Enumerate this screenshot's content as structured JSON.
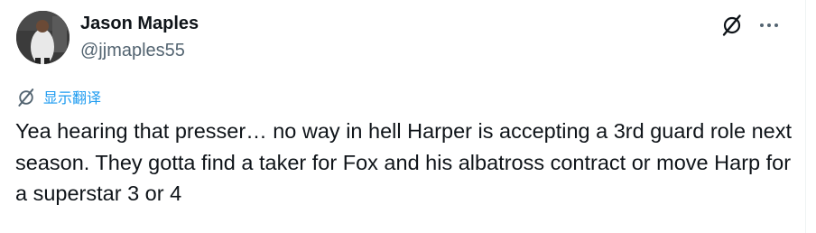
{
  "tweet": {
    "author": {
      "display_name": "Jason Maples",
      "handle": "@jjmaples55",
      "avatar": "avatar-photo"
    },
    "actions": {
      "grok_icon": "grok-icon",
      "more_icon": "more-horizontal-icon"
    },
    "translate": {
      "icon": "grok-translate-icon",
      "label": "显示翻译"
    },
    "text": "Yea hearing that presser… no way in hell Harper is accepting a 3rd guard role next season. They gotta find a taker for Fox and his albatross contract or move Harp for a superstar 3 or 4"
  },
  "colors": {
    "text_primary": "#0f1419",
    "text_secondary": "#536471",
    "accent": "#1d9bf0",
    "border": "#eff3f4"
  }
}
